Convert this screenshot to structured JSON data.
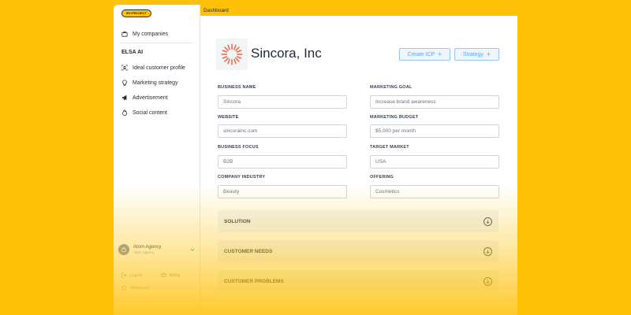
{
  "sidebar": {
    "logo_text": "MY-PROJECT",
    "my_companies": "My companies",
    "section_title": "ELSA AI",
    "items": [
      {
        "label": "Ideal customer profile",
        "icon": "scan-user-icon"
      },
      {
        "label": "Marketing strategy",
        "icon": "lightbulb-icon"
      },
      {
        "label": "Advertisement",
        "icon": "megaphone-icon"
      },
      {
        "label": "Social content",
        "icon": "flame-icon"
      }
    ],
    "agency": {
      "name": "Atom Agency",
      "subtitle": "Atom Agency"
    },
    "footer": {
      "logout": "Logout",
      "billing": "Billing",
      "third": "Workspace"
    }
  },
  "header": {
    "title": "Dashboard"
  },
  "company": {
    "name": "Sincora, Inc"
  },
  "buttons": {
    "create_icp": "Create ICP",
    "strategy": "Strategy"
  },
  "fields": {
    "business_name": {
      "label": "BUSINESS NAME",
      "value": "Sincora"
    },
    "website": {
      "label": "WEBSITE",
      "value": "sincorainc.com"
    },
    "business_focus": {
      "label": "BUSINESS FOCUS",
      "value": "B2B"
    },
    "company_industry": {
      "label": "COMPANY INDUSTRY",
      "value": "Beauty"
    },
    "marketing_goal": {
      "label": "MARKETING GOAL",
      "value": "Increase brand awareness"
    },
    "marketing_budget": {
      "label": "MARKETING BUDGET",
      "value": "$5,000 per month"
    },
    "target_market": {
      "label": "TARGET MARKET",
      "value": "USA"
    },
    "offering": {
      "label": "OFFERING",
      "value": "Cosmetics"
    }
  },
  "accordions": [
    "SOLUTION",
    "CUSTOMER NEEDS",
    "CUSTOMER PROBLEMS"
  ],
  "colors": {
    "background": "#FFC107",
    "accent_blue": "#60a5fa",
    "logo_orange": "#e8684a"
  }
}
